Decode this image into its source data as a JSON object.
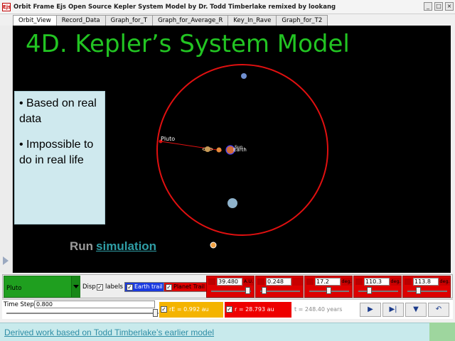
{
  "window": {
    "title": "Orbit Frame Ejs Open Source Kepler System Model by Dr. Todd Timberlake remixed by lookang",
    "icon_label": "Ejs",
    "buttons": [
      "_",
      "□",
      "×"
    ]
  },
  "tabs": [
    {
      "label": "Orbit_View",
      "active": true
    },
    {
      "label": "Record_Data",
      "active": false
    },
    {
      "label": "Graph_for_T",
      "active": false
    },
    {
      "label": "Graph_for_Average_R",
      "active": false
    },
    {
      "label": "Key_In_Rave",
      "active": false
    },
    {
      "label": "Graph_for_T2",
      "active": false
    }
  ],
  "slide": {
    "heading": "4D. Kepler’s System Model",
    "bullets": [
      "• Based on real data",
      "• Impossible to do in real life"
    ],
    "run_text": "Run",
    "run_link": "simulation"
  },
  "orbit_view": {
    "labels": {
      "pluto": "Pluto",
      "earth": "Earth",
      "sun": "Sun"
    },
    "colors": {
      "orbit": "#e01010",
      "label": "#ffffff",
      "background": "#000000"
    }
  },
  "controls": {
    "planet_value": "Pluto",
    "disp_label": "Disp",
    "labels_checkbox": "labels",
    "earth_trail": "Earth trail",
    "planet_trail": "Planet Trail",
    "params": [
      {
        "value": "39.480",
        "unit": "A.U."
      },
      {
        "value": "0.248",
        "unit": ""
      },
      {
        "value": "17.2",
        "unit": "deg."
      },
      {
        "value": "110.3",
        "unit": "deg."
      },
      {
        "value": "113.8",
        "unit": "deg."
      }
    ],
    "time_step_label": "Time Step:",
    "time_step_value": "0.800",
    "rE": "rE = 0.992 au",
    "r": "r = 28.793 au",
    "t": "t = 248.40 years",
    "buttons": [
      "▶",
      "▶|",
      "▼",
      "↶"
    ]
  },
  "banner": {
    "text": "Derived work based on Todd Timberlake’s earlier model"
  }
}
